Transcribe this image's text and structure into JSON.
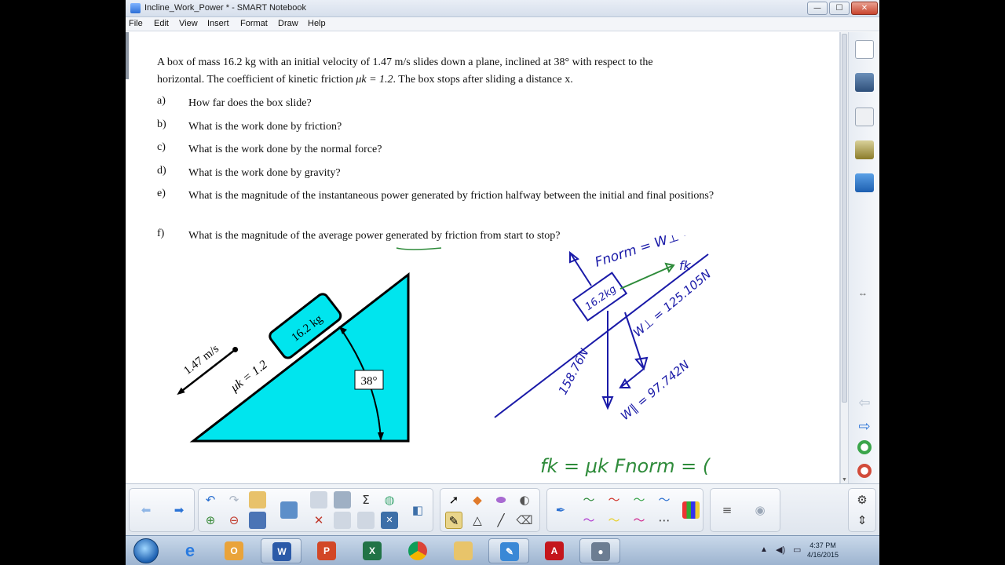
{
  "window": {
    "title": "Incline_Work_Power * - SMART Notebook",
    "minimize": "—",
    "maximize": "☐",
    "close": "✕"
  },
  "menu": [
    "File",
    "Edit",
    "View",
    "Insert",
    "Format",
    "Draw",
    "Help"
  ],
  "problem": {
    "line1": "A box of mass 16.2 kg with an initial velocity of 1.47 m/s slides down a plane, inclined at 38° with respect to the",
    "line2a": "horizontal. The coefficient of kinetic friction ",
    "mu": "μk = 1.2",
    "line2b": ". The box stops after sliding a distance x.",
    "questions": [
      {
        "label": "a)",
        "text": "How far does the box slide?"
      },
      {
        "label": "b)",
        "text": "What is the work done by friction?"
      },
      {
        "label": "c)",
        "text": "What is the work done by the normal force?"
      },
      {
        "label": "d)",
        "text": "What is the work done by gravity?"
      },
      {
        "label": "e)",
        "text": "What is the magnitude of the instantaneous power generated by friction halfway between the initial and final positions?"
      },
      {
        "label": "f)",
        "text": "What is the magnitude of the average power generated by friction from start to stop?"
      }
    ]
  },
  "diagram": {
    "box_mass": "16.2 kg",
    "velocity": "1.47 m/s",
    "mu": "μk = 1.2",
    "angle": "38°"
  },
  "handwriting": {
    "box": "16.2kg",
    "fnorm": "Fnorm = W⊥ = 125.105N",
    "fk": "fk",
    "wperp": "W⊥ = 125.105N",
    "wpar": "W∥ = 97.742N",
    "normal_len": "158.76N",
    "equation": "fk = μk Fnorm = ("
  },
  "taskbar": {
    "time": "4:37 PM",
    "date": "4/16/2015"
  },
  "colors": {
    "triangle": "#00e5ee",
    "ink_blue": "#1a1aa8",
    "ink_green": "#2e8b3a"
  }
}
